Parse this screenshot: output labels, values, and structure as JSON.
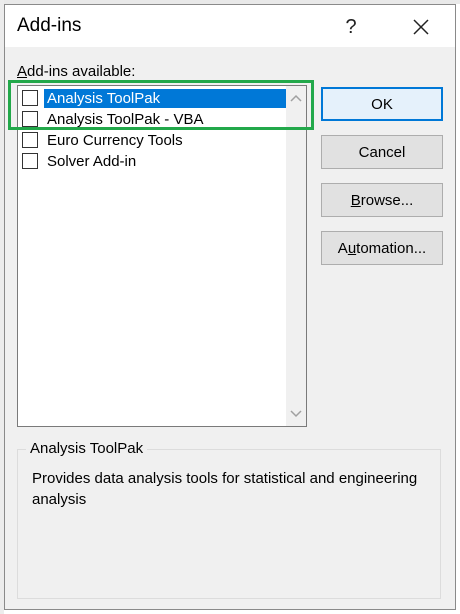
{
  "dialog": {
    "title": "Add-ins",
    "help_glyph": "?",
    "close_icon": "close-icon"
  },
  "addins_list": {
    "label_prefix": "",
    "label_access": "A",
    "label_rest": "dd-ins available:",
    "items": [
      {
        "label": "Analysis ToolPak",
        "checked": false,
        "selected": true
      },
      {
        "label": "Analysis ToolPak - VBA",
        "checked": false,
        "selected": false
      },
      {
        "label": "Euro Currency Tools",
        "checked": false,
        "selected": false
      },
      {
        "label": "Solver Add-in",
        "checked": false,
        "selected": false
      }
    ]
  },
  "buttons": {
    "ok": "OK",
    "cancel": "Cancel",
    "browse_access": "B",
    "browse_rest": "rowse...",
    "automation_pre": "A",
    "automation_access": "u",
    "automation_rest": "tomation..."
  },
  "description": {
    "title": "Analysis ToolPak",
    "text": "Provides data analysis tools for statistical and engineering analysis"
  },
  "colors": {
    "selection": "#0078d7",
    "highlight_box": "#22a84a",
    "dialog_bg": "#f0f0f0"
  }
}
